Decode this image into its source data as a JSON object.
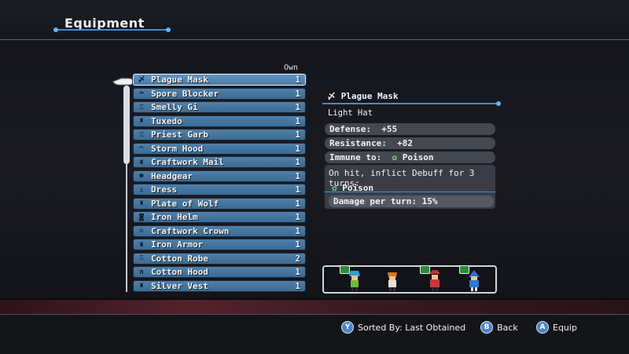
{
  "header": {
    "title": "Equipment"
  },
  "list": {
    "own_label": "Own",
    "items": [
      {
        "name": "Plague Mask",
        "qty": "1",
        "icon": "mask-icon",
        "glyph": "〆",
        "selected": true
      },
      {
        "name": "Spore Blocker",
        "qty": "1",
        "icon": "hat-icon",
        "glyph": "⌓"
      },
      {
        "name": "Smelly Gi",
        "qty": "1",
        "icon": "armor-icon",
        "glyph": "♖"
      },
      {
        "name": "Tuxedo",
        "qty": "1",
        "icon": "armor-icon",
        "glyph": "♜"
      },
      {
        "name": "Priest Garb",
        "qty": "1",
        "icon": "armor-icon",
        "glyph": "♖"
      },
      {
        "name": "Storm Hood",
        "qty": "1",
        "icon": "hat-icon",
        "glyph": "⌒"
      },
      {
        "name": "Craftwork Mail",
        "qty": "1",
        "icon": "armor-icon",
        "glyph": "♜"
      },
      {
        "name": "Headgear",
        "qty": "1",
        "icon": "helmet-icon",
        "glyph": "◉"
      },
      {
        "name": "Dress",
        "qty": "1",
        "icon": "robe-icon",
        "glyph": "♙"
      },
      {
        "name": "Plate of Wolf",
        "qty": "1",
        "icon": "armor-icon",
        "glyph": "♜"
      },
      {
        "name": "Iron Helm",
        "qty": "1",
        "icon": "helmet-icon",
        "glyph": "◙"
      },
      {
        "name": "Craftwork Crown",
        "qty": "1",
        "icon": "crown-icon",
        "glyph": "♔"
      },
      {
        "name": "Iron Armor",
        "qty": "1",
        "icon": "armor-icon",
        "glyph": "♜"
      },
      {
        "name": "Cotton Robe",
        "qty": "2",
        "icon": "robe-icon",
        "glyph": "♖"
      },
      {
        "name": "Cotton Hood",
        "qty": "1",
        "icon": "hood-icon",
        "glyph": "∩"
      },
      {
        "name": "Silver Vest",
        "qty": "1",
        "icon": "armor-icon",
        "glyph": "♜"
      }
    ]
  },
  "detail": {
    "name": "Plague Mask",
    "subtype": "Light Hat",
    "defense_label": "Defense:",
    "defense_value": "+55",
    "resistance_label": "Resistance:",
    "resistance_value": "+82",
    "immune_label": "Immune to:",
    "immune_value": "Poison",
    "debuff_text": "On hit, inflict Debuff for 3 turns:",
    "debuff_name": "Poison",
    "damage_text": "Damage per turn:  15%"
  },
  "footer": {
    "sort_button": "Y",
    "sort_label": "Sorted By: Last Obtained",
    "back_button": "B",
    "back_label": "Back",
    "equip_button": "A",
    "equip_label": "Equip"
  }
}
